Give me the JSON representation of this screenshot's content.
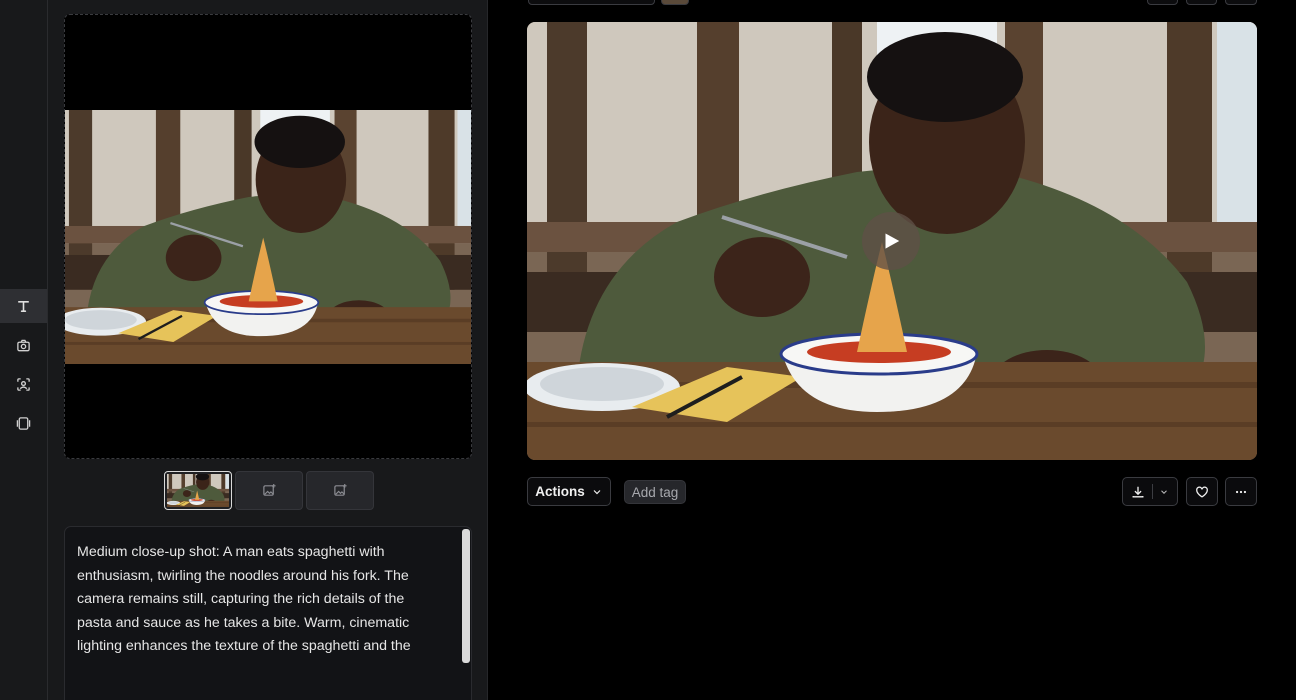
{
  "sidebar": {
    "tools": [
      {
        "name": "text-tool",
        "icon": "text-icon",
        "active": true
      },
      {
        "name": "image-tool",
        "icon": "camera-icon",
        "active": false
      },
      {
        "name": "character-tool",
        "icon": "face-scan-icon",
        "active": false
      },
      {
        "name": "frames-tool",
        "icon": "frames-icon",
        "active": false
      }
    ]
  },
  "panel": {
    "thumbnails": [
      {
        "type": "image",
        "selected": true
      },
      {
        "type": "add-image",
        "icon": "image-plus-icon"
      },
      {
        "type": "add-image",
        "icon": "image-plus-icon"
      }
    ],
    "prompt": "Medium close-up shot: A man eats spaghetti with enthusiasm, twirling the noodles around his fork. The camera remains still, capturing the rich details of the pasta and sauce as he takes a bite. Warm, cinematic lighting enhances the texture of the spaghetti and the"
  },
  "result": {
    "play_icon": "play-icon",
    "toolbar": {
      "actions_label": "Actions",
      "add_tag_label": "Add tag",
      "download_icon": "download-icon",
      "like_icon": "heart-icon",
      "more_icon": "more-horizontal-icon"
    }
  },
  "colors": {
    "background": "#000000",
    "panel": "#18191b",
    "active_tool": "#2e2f33",
    "button_border": "#3a3b40"
  }
}
